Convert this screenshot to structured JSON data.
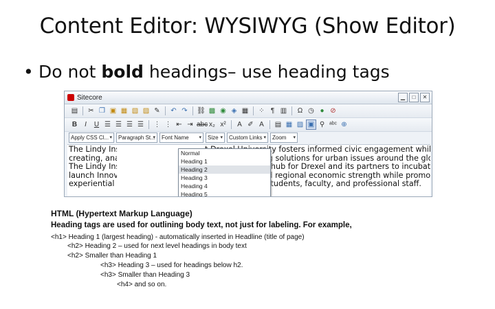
{
  "slide": {
    "title": "Content Editor: WYSIWYG (Show Editor)",
    "bullet": {
      "pre": "Do not ",
      "bold": "bold",
      "post": " headings– use heading tags"
    }
  },
  "editor": {
    "window_title": "Sitecore",
    "dropdowns": {
      "apply_css": "Apply CSS Cl...",
      "paragraph_style": "Paragraph St...",
      "font_name": "Font Name",
      "size": "Size",
      "custom_links": "Custom Links",
      "zoom": "Zoom"
    },
    "paragraph_menu": [
      "Normal",
      "Heading 1",
      "Heading 2",
      "Heading 3",
      "Heading 4",
      "Heading 5"
    ],
    "paragraph_menu_selected": 2,
    "content_left": [
      "The Lindy Inst",
      "creating, analy",
      "The Lindy Inst",
      "launch Innovat",
      "experiential le"
    ],
    "content_right": [
      "t Drexel University fosters informed civic engagement while",
      "nating pioneering solutions for urban issues around the globe.",
      "multidisciplinary hub for Drexel and its partners to incubate and",
      "tiatives that build regional economic strength while promoting",
      "holarly work by students, faculty, and professional staff."
    ]
  },
  "notes": {
    "heading": "HTML (Hypertext Markup Language)",
    "subheading": "Heading tags are used for outlining body text, not just for labeling. For example,",
    "lines": [
      "<h1> Heading 1 (largest heading) - automatically inserted in Headline (title of page)",
      "<h2> Heading 2 – used for next level headings in body text",
      "<h2> Smaller than Heading 1",
      "<h3> Heading 3 – used for headings below h2.",
      "<h3> Smaller than Heading 3",
      "<h4> and so on."
    ]
  }
}
